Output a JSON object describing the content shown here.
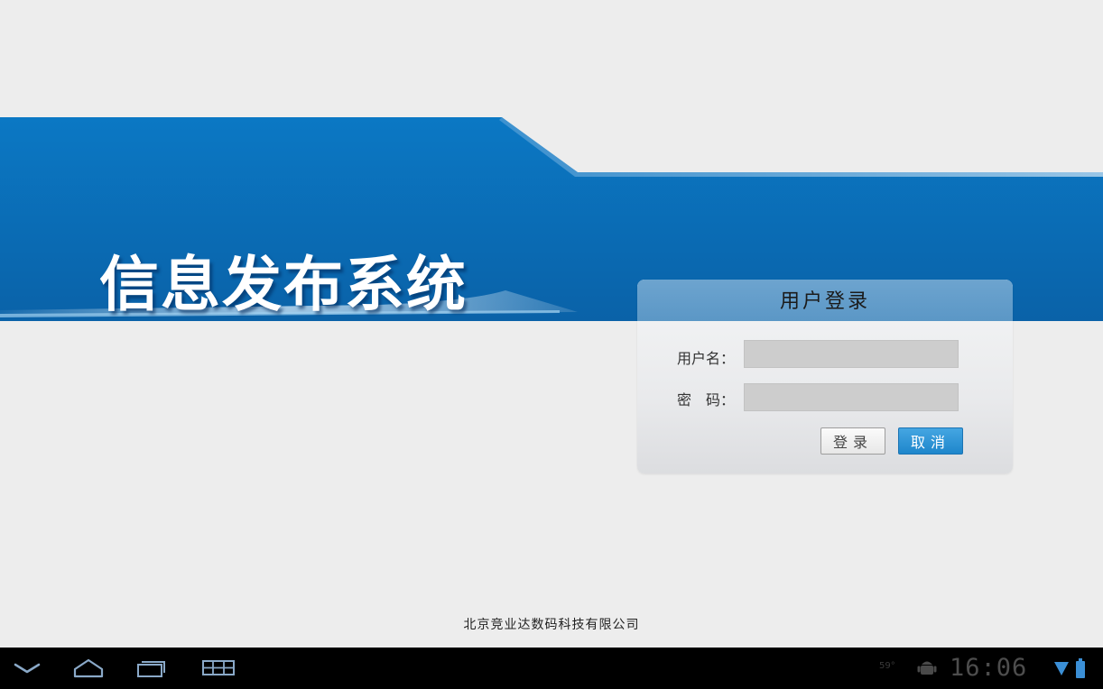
{
  "app": {
    "title": "信息发布系统"
  },
  "login": {
    "header": "用户登录",
    "username_label": "用户名：",
    "password_label": "密　码：",
    "username_value": "",
    "password_value": "",
    "login_button": "登录",
    "cancel_button": "取消"
  },
  "footer": {
    "company": "北京竞业达数码科技有限公司"
  },
  "system_bar": {
    "temperature": "59°",
    "clock": "16:06",
    "icons": [
      "back-icon",
      "home-icon",
      "recent-apps-icon",
      "menu-icon",
      "android-debug-icon",
      "wifi-signal-icon",
      "battery-icon"
    ]
  },
  "colors": {
    "banner_blue": "#0c6fb8",
    "panel_header": "#639ecb",
    "cancel_button": "#2a90d3",
    "background": "#ededed",
    "system_bar": "#000000"
  }
}
